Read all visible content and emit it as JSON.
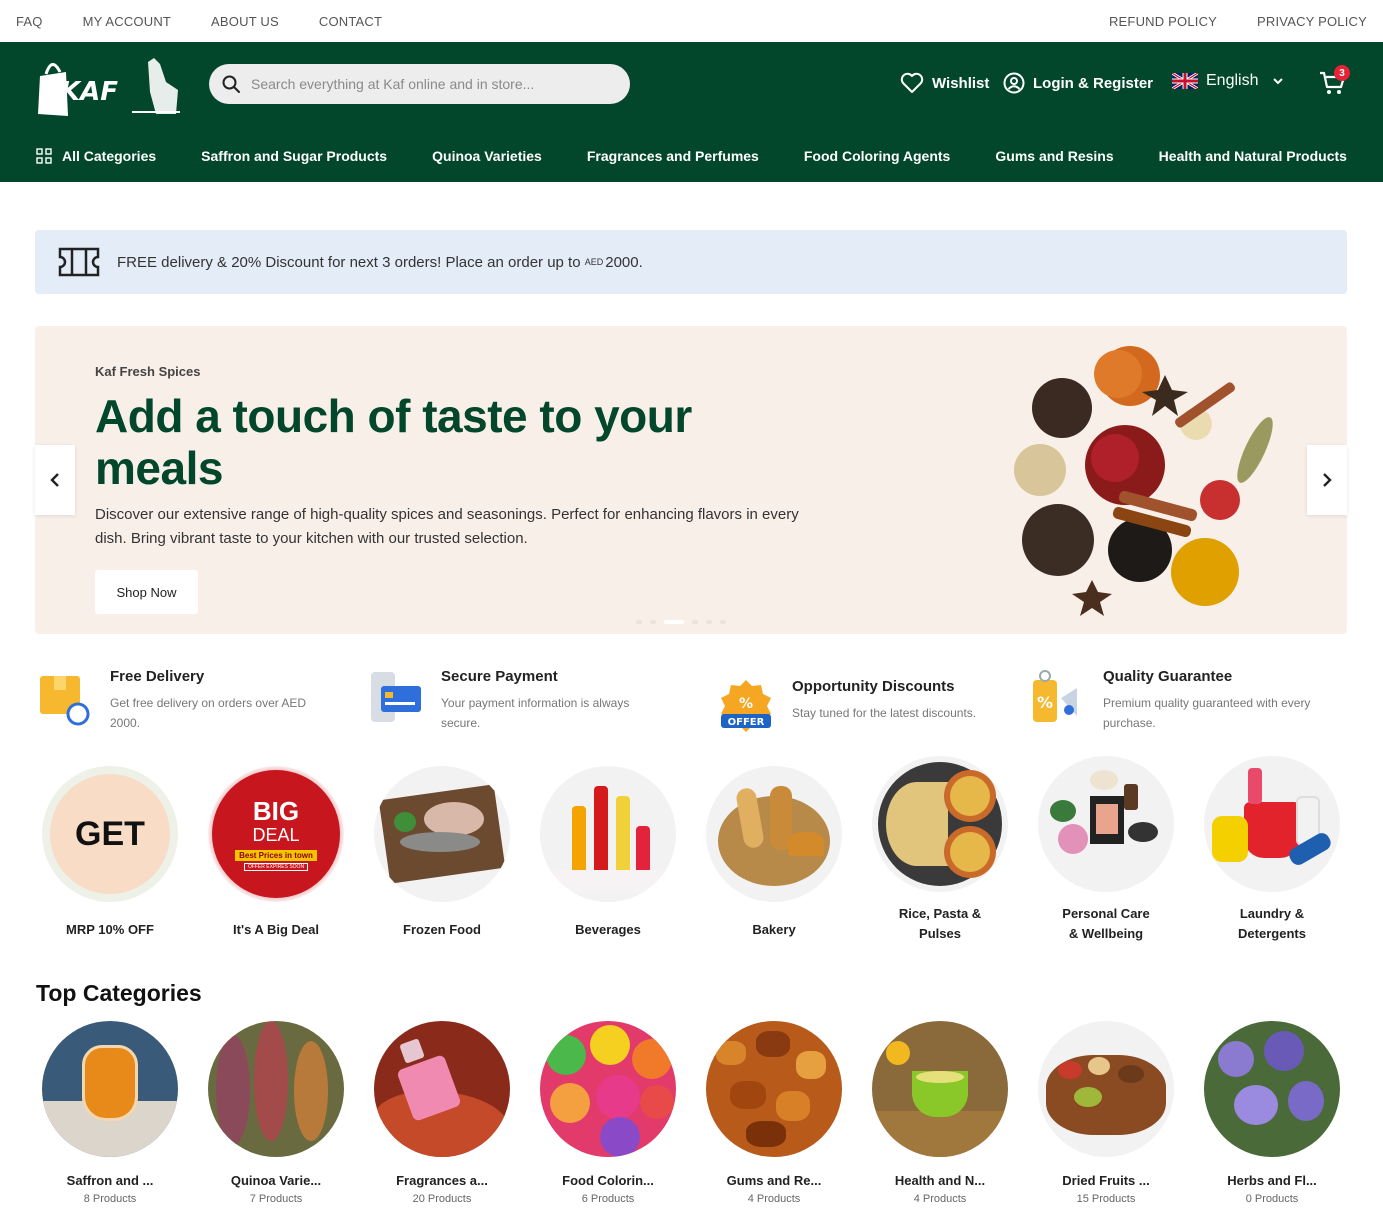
{
  "topbar": {
    "left": [
      "FAQ",
      "MY ACCOUNT",
      "ABOUT US",
      "CONTACT"
    ],
    "right": [
      "REFUND POLICY",
      "PRIVACY POLICY"
    ]
  },
  "header": {
    "logo_text": "KAF",
    "search_placeholder": "Search everything at Kaf online and in store...",
    "wishlist": "Wishlist",
    "login": "Login & Register",
    "language": "English",
    "cart_count": "3"
  },
  "catnav": {
    "all": "All Categories",
    "items": [
      "Saffron and Sugar Products",
      "Quinoa Varieties",
      "Fragrances and Perfumes",
      "Food Coloring Agents",
      "Gums and Resins",
      "Health and Natural Products"
    ]
  },
  "promo": {
    "text_before": "FREE delivery & 20% Discount for next 3 orders! Place an order up to ",
    "currency": "AED",
    "amount": "2000."
  },
  "hero": {
    "eyebrow": "Kaf Fresh Spices",
    "title": "Add a touch of taste to your meals",
    "description": "Discover our extensive range of high-quality spices and seasonings. Perfect for enhancing flavors in every dish. Bring vibrant taste to your kitchen with our trusted selection.",
    "button": "Shop Now"
  },
  "features": [
    {
      "title": "Free Delivery",
      "text": "Get free delivery on orders over AED 2000."
    },
    {
      "title": "Secure Payment",
      "text": "Your payment information is always secure."
    },
    {
      "title": "Opportunity Discounts",
      "text": "Stay tuned for the latest discounts."
    },
    {
      "title": "Quality Guarantee",
      "text": "Premium quality guaranteed with every purchase."
    }
  ],
  "promo_circles": {
    "get_text": "GET",
    "big": "BIG",
    "deal": "DEAL",
    "best_prices": "Best Prices in town",
    "offer_expires": "OFFER EXPIRES SOON",
    "items": [
      "MRP 10% OFF",
      "It's A Big Deal",
      "Frozen Food",
      "Beverages",
      "Bakery",
      "Rice, Pasta & Pulses",
      "Personal Care & Wellbeing",
      "Laundry & Detergents"
    ]
  },
  "top_categories": {
    "title": "Top Categories",
    "items": [
      {
        "name": "Saffron and ...",
        "count": "8 Products"
      },
      {
        "name": "Quinoa Varie...",
        "count": "7 Products"
      },
      {
        "name": "Fragrances a...",
        "count": "20 Products"
      },
      {
        "name": "Food Colorin...",
        "count": "6 Products"
      },
      {
        "name": "Gums and Re...",
        "count": "4 Products"
      },
      {
        "name": "Health and N...",
        "count": "4 Products"
      },
      {
        "name": "Dried Fruits ...",
        "count": "15 Products"
      },
      {
        "name": "Herbs and Fl...",
        "count": "0 Products"
      }
    ]
  },
  "colors": {
    "brand_green": "#02472b",
    "promo_bg": "#e3ecf7",
    "hero_bg": "#f9efe9",
    "badge_red": "#e52236"
  }
}
